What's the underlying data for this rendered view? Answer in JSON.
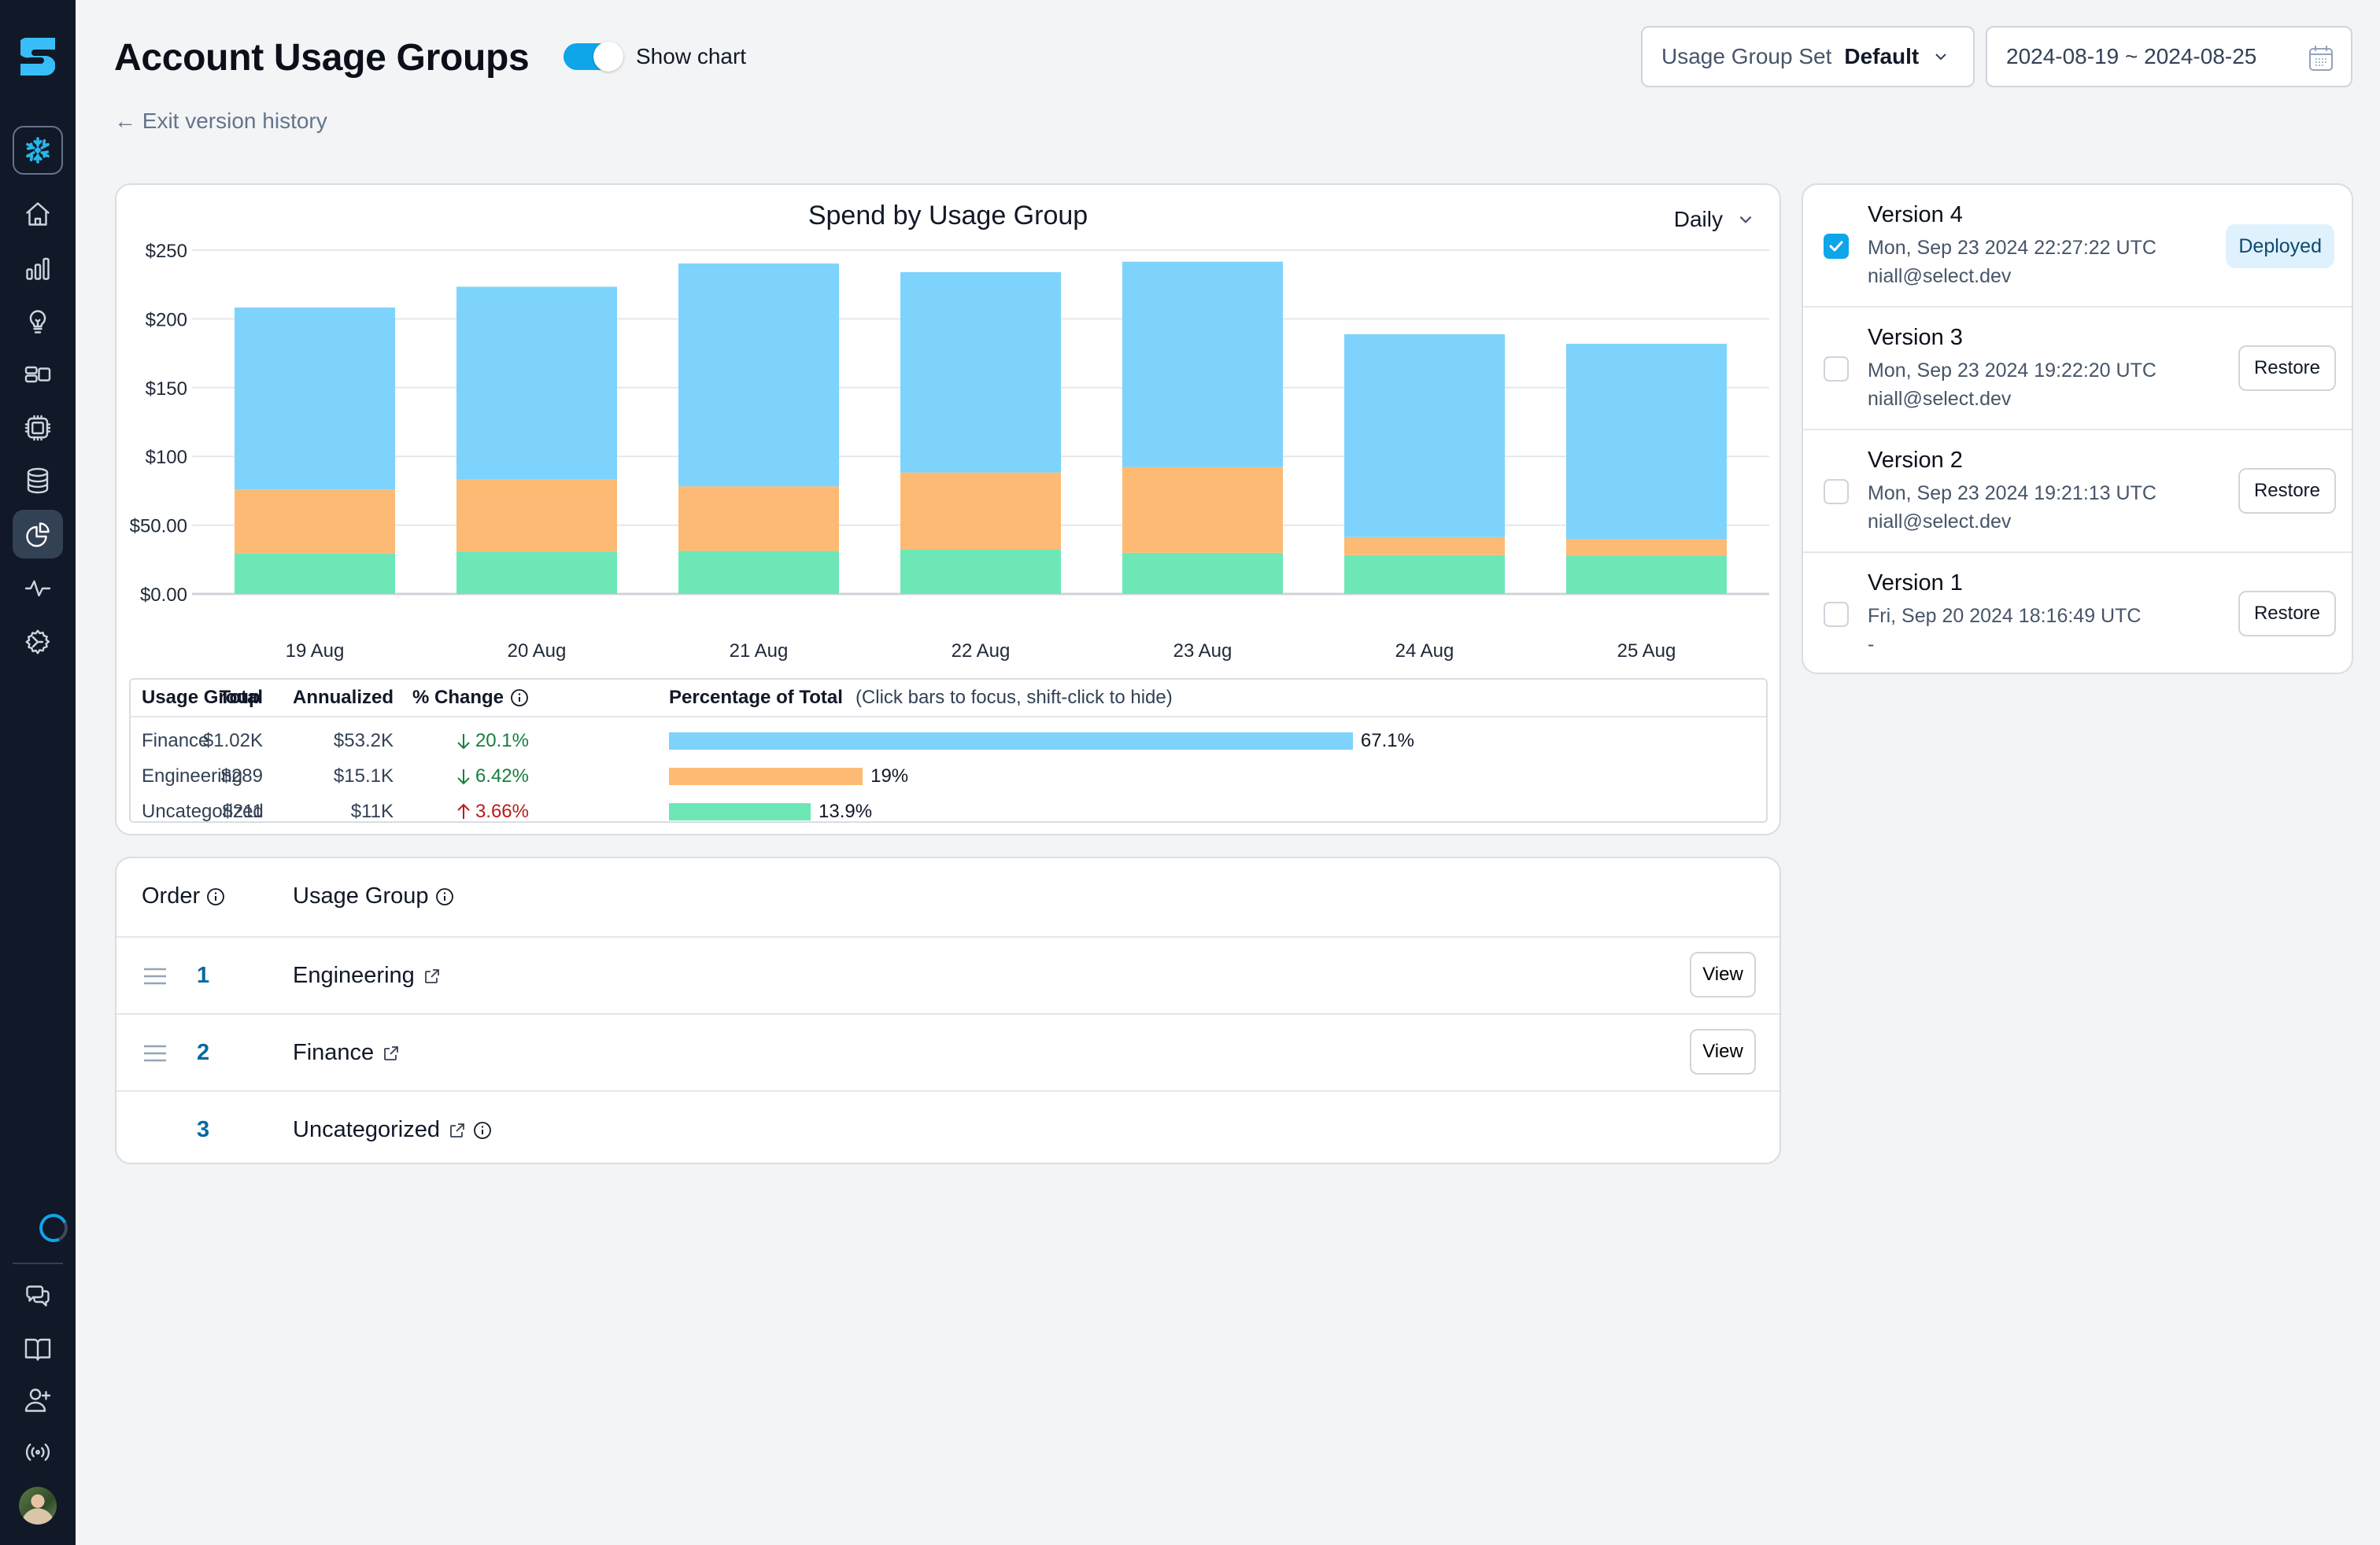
{
  "sidebar": {
    "items": [
      {
        "name": "snowflake-icon",
        "label": "Snowflake"
      },
      {
        "name": "home-icon",
        "label": "Home"
      },
      {
        "name": "bar-chart-icon",
        "label": "Usage"
      },
      {
        "name": "lightbulb-icon",
        "label": "Insights"
      },
      {
        "name": "layout-icon",
        "label": "Workloads"
      },
      {
        "name": "cpu-icon",
        "label": "Warehouses"
      },
      {
        "name": "database-icon",
        "label": "Storage"
      },
      {
        "name": "pie-chart-icon",
        "label": "Usage Groups",
        "active": true
      },
      {
        "name": "activity-icon",
        "label": "Monitoring"
      },
      {
        "name": "settings-icon",
        "label": "Settings"
      }
    ],
    "bottom_items": [
      {
        "name": "chat-icon",
        "label": "Feedback"
      },
      {
        "name": "book-icon",
        "label": "Docs"
      },
      {
        "name": "user-plus-icon",
        "label": "Invite"
      },
      {
        "name": "broadcast-icon",
        "label": "Status"
      }
    ]
  },
  "header": {
    "title": "Account Usage Groups",
    "toggle_label": "Show chart",
    "toggle_on": true,
    "exit_link": "← Exit version history",
    "usage_group_set_label": "Usage Group Set",
    "usage_group_set_value": "Default",
    "date_range": "2024-08-19 ~ 2024-08-25"
  },
  "chart_section": {
    "interval": "Daily"
  },
  "colors": {
    "finance": "#7dd3fc",
    "engineering": "#fdba74",
    "uncategorized": "#6ee7b7",
    "accent": "#0ea5e9",
    "down": "#15803d",
    "up": "#b91c1c"
  },
  "chart_data": {
    "type": "bar",
    "stacked": true,
    "title": "Spend by Usage Group",
    "xlabel": "",
    "ylabel": "",
    "categories": [
      "19 Aug",
      "20 Aug",
      "21 Aug",
      "22 Aug",
      "23 Aug",
      "24 Aug",
      "25 Aug"
    ],
    "series": [
      {
        "name": "Uncategorized",
        "color": "#6ee7b7",
        "values": [
          29.5,
          30.8,
          31.2,
          32.3,
          29.9,
          28.2,
          27.8
        ]
      },
      {
        "name": "Engineering",
        "color": "#fdba74",
        "values": [
          46.4,
          52.5,
          47.0,
          56.0,
          62.4,
          13.1,
          12.0
        ]
      },
      {
        "name": "Finance",
        "color": "#7dd3fc",
        "values": [
          132.4,
          140.1,
          162.1,
          145.7,
          149.3,
          147.6,
          142.1
        ]
      }
    ],
    "ylim": [
      0,
      250
    ],
    "yticks": [
      0,
      50,
      100,
      150,
      200,
      250
    ],
    "ytick_labels": [
      "$0.00",
      "$50.00",
      "$100",
      "$150",
      "$200",
      "$250"
    ],
    "grid": true,
    "legend": "none"
  },
  "summary": {
    "headers": {
      "group": "Usage Group",
      "total": "Total",
      "annualized": "Annualized",
      "change": "% Change",
      "percentage": "Percentage of Total",
      "hint": "(Click bars to focus, shift-click to hide)"
    },
    "rows": [
      {
        "group": "Finance",
        "total": "$1.02K",
        "annualized": "$53.2K",
        "change": "20.1%",
        "direction": "down",
        "pct": 67.1,
        "pct_label": "67.1%",
        "color": "#7dd3fc"
      },
      {
        "group": "Engineering",
        "total": "$289",
        "annualized": "$15.1K",
        "change": "6.42%",
        "direction": "down",
        "pct": 19,
        "pct_label": "19%",
        "color": "#fdba74"
      },
      {
        "group": "Uncategorized",
        "total": "$211",
        "annualized": "$11K",
        "change": "3.66%",
        "direction": "up",
        "pct": 13.9,
        "pct_label": "13.9%",
        "color": "#6ee7b7"
      }
    ]
  },
  "versions": [
    {
      "title": "Version 4",
      "date": "Mon, Sep 23 2024 22:27:22 UTC",
      "user": "niall@select.dev",
      "checked": true,
      "status": "Deployed"
    },
    {
      "title": "Version 3",
      "date": "Mon, Sep 23 2024 19:22:20 UTC",
      "user": "niall@select.dev",
      "checked": false,
      "action": "Restore"
    },
    {
      "title": "Version 2",
      "date": "Mon, Sep 23 2024 19:21:13 UTC",
      "user": "niall@select.dev",
      "checked": false,
      "action": "Restore"
    },
    {
      "title": "Version 1",
      "date": "Fri, Sep 20 2024 18:16:49 UTC",
      "user": "-",
      "checked": false,
      "action": "Restore"
    }
  ],
  "order_table": {
    "headers": {
      "order": "Order",
      "group": "Usage Group"
    },
    "rows": [
      {
        "order": "1",
        "group": "Engineering",
        "draggable": true,
        "action": "View"
      },
      {
        "order": "2",
        "group": "Finance",
        "draggable": true,
        "action": "View"
      },
      {
        "order": "3",
        "group": "Uncategorized",
        "draggable": false,
        "info": true
      }
    ]
  }
}
